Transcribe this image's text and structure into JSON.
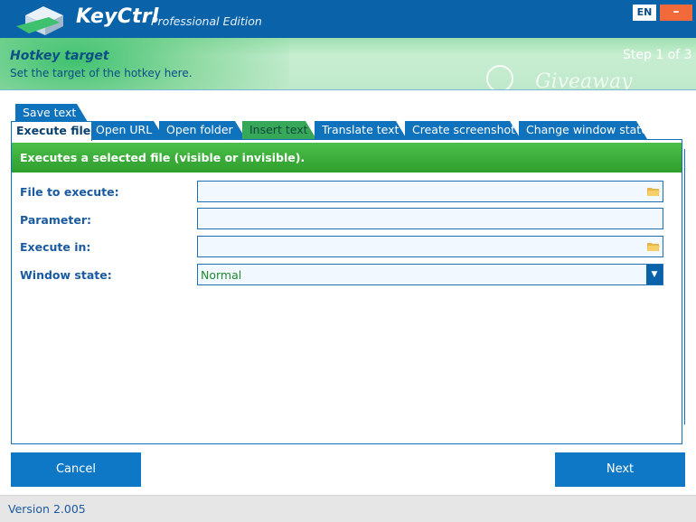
{
  "window": {
    "app_name": "KeyCtrl",
    "edition": "Professional Edition",
    "language": "EN",
    "close_glyph": "–"
  },
  "header": {
    "title": "Hotkey target",
    "subtitle": "Set the target of the hotkey here.",
    "step": "Step 1 of 3",
    "watermark": "Giveaway"
  },
  "tabs": {
    "row1": [
      {
        "label": "Save text"
      }
    ],
    "row2": [
      {
        "label": "Execute file",
        "active": true
      },
      {
        "label": "Open URL"
      },
      {
        "label": "Open folder"
      },
      {
        "label": "Insert text"
      },
      {
        "label": "Translate text"
      },
      {
        "label": "Create screenshot"
      },
      {
        "label": "Change window state"
      }
    ]
  },
  "panel": {
    "description": "Executes a selected file (visible or invisible).",
    "fields": [
      {
        "label": "File to execute:",
        "value": "",
        "icon": "folder-icon"
      },
      {
        "label": "Parameter:",
        "value": ""
      },
      {
        "label": "Execute in:",
        "value": "",
        "icon": "folder-icon"
      },
      {
        "label": "Window state:",
        "value": "Normal",
        "icon": "chevron-down-icon"
      }
    ]
  },
  "buttons": {
    "cancel": "Cancel",
    "next": "Next"
  },
  "status": {
    "version": "Version 2.005"
  },
  "colors": {
    "titlebar": "#0a63a8",
    "accent_blue": "#0e72bd",
    "banner_green": "#2e9e2c",
    "close_orange": "#f26a3a"
  }
}
